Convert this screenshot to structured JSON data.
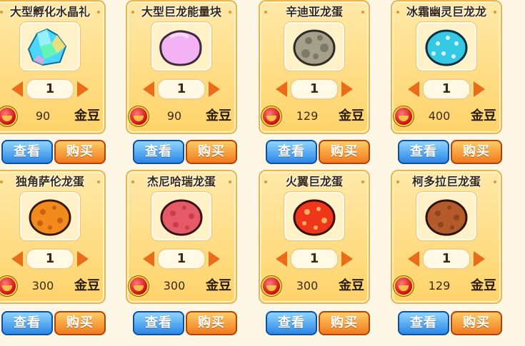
{
  "shop": {
    "currency_label": "金豆",
    "buttons": {
      "view_label": "查看",
      "buy_label": "购买"
    },
    "items": [
      {
        "name": "大型孵化水晶礼",
        "qty": "1",
        "price": "90",
        "icon": "crystal-icon",
        "color": "#4bd6ff"
      },
      {
        "name": "大型巨龙能量块",
        "qty": "1",
        "price": "90",
        "icon": "pink-energy-block-icon",
        "color": "#f3b2f4"
      },
      {
        "name": "辛迪亚龙蛋",
        "qty": "1",
        "price": "129",
        "icon": "gray-spotted-egg-icon",
        "color": "#a6a08b"
      },
      {
        "name": "冰霜幽灵巨龙龙",
        "qty": "1",
        "price": "400",
        "icon": "cyan-spotted-egg-icon",
        "color": "#35c9e6"
      },
      {
        "name": "独角萨伦龙蛋",
        "qty": "1",
        "price": "300",
        "icon": "orange-spotted-egg-icon",
        "color": "#f28b1c"
      },
      {
        "name": "杰尼哈瑞龙蛋",
        "qty": "1",
        "price": "300",
        "icon": "red-spotted-egg-icon",
        "color": "#e55a66"
      },
      {
        "name": "火翼巨龙蛋",
        "qty": "1",
        "price": "300",
        "icon": "fire-spotted-egg-icon",
        "color": "#f0361a"
      },
      {
        "name": "柯多拉巨龙蛋",
        "qty": "1",
        "price": "129",
        "icon": "brown-spotted-egg-icon",
        "color": "#b45a2b"
      }
    ]
  }
}
